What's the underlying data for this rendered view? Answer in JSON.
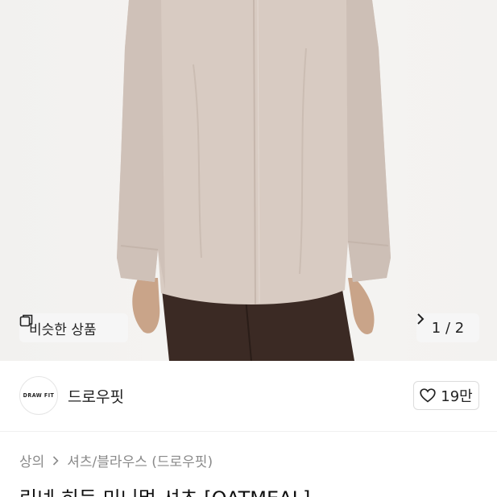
{
  "product_image": {
    "similar_button_label": "비슷한 상품",
    "similar_icon": "copy-icon",
    "pager_text": "1 / 2",
    "pager_icon": "chevron-right-icon"
  },
  "seller": {
    "logo_text": "DRAW FIT",
    "name": "드로우핏",
    "like_count": "19만",
    "like_icon": "heart-outline-icon"
  },
  "breadcrumb": {
    "category": "상의",
    "subcategory": "셔츠/블라우스 (드로우핏)",
    "separator_icon": "chevron-right-icon"
  },
  "product": {
    "title": "린넨 히든 미니멀 셔츠 [OATMEAL]"
  },
  "colors": {
    "shirt": "#d8cbc2",
    "pants": "#3b2a24",
    "background": "#f3f2f0"
  }
}
